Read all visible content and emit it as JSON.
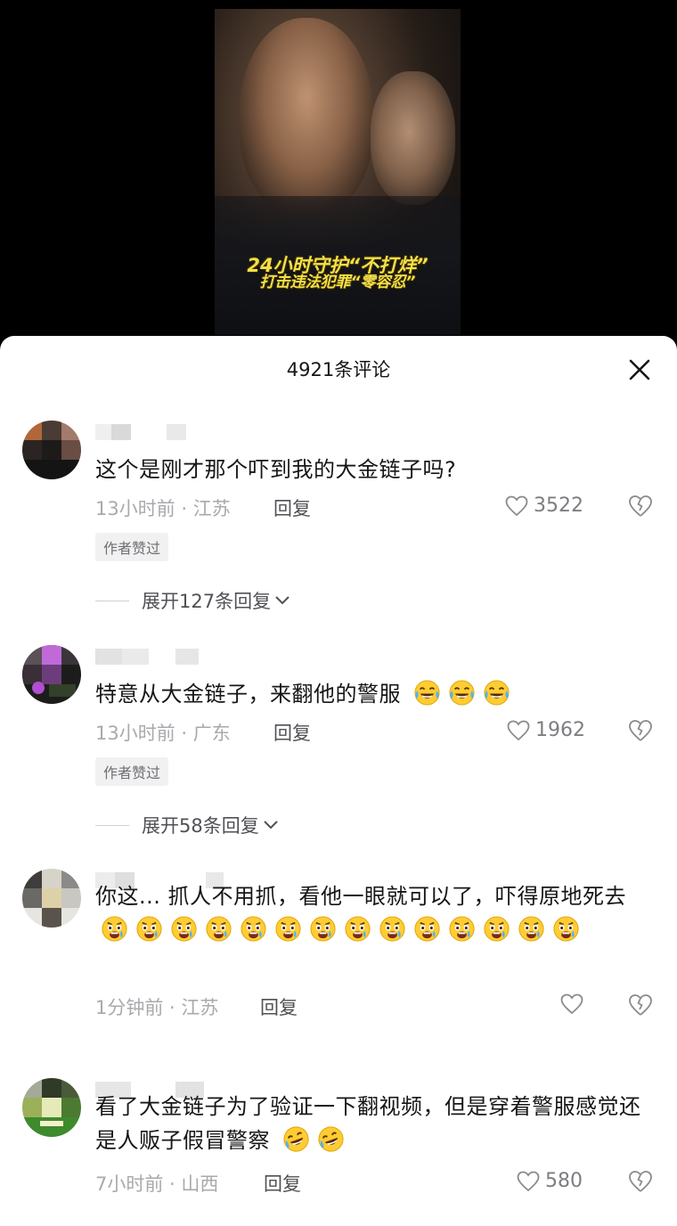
{
  "video": {
    "caption_line1": "24小时守护“不打烊”",
    "caption_line2": "打击违法犯罪“零容忍”"
  },
  "sheet": {
    "title": "4921条评论"
  },
  "comments": [
    {
      "text": "这个是刚才那个吓到我的大金链子吗?",
      "meta": "13小时前 · 江苏",
      "reply_label": "回复",
      "likes": "3522",
      "badge": "作者赞过",
      "expand": "展开127条回复"
    },
    {
      "text": "特意从大金链子，来翻他的警服",
      "emoji": "laugh-cry-emoji",
      "emoji_count": 3,
      "meta": "13小时前 · 广东",
      "reply_label": "回复",
      "likes": "1962",
      "badge": "作者赞过",
      "expand": "展开58条回复"
    },
    {
      "text": "你这... 抓人不用抓，看他一眼就可以了，吓得原地死去",
      "emoji": "scared-emoji",
      "emoji_count": 14,
      "meta": "1分钟前 · 江苏",
      "reply_label": "回复",
      "likes": ""
    },
    {
      "text": "看了大金链子为了验证一下翻视频，但是穿着警服感觉还是人贩子假冒警察",
      "emoji": "rofl-emoji",
      "emoji_count": 2,
      "meta": "7小时前 · 山西",
      "reply_label": "回复",
      "likes": "580"
    }
  ],
  "colors": {
    "sheet_bg": "#ffffff",
    "text_primary": "#161616",
    "text_meta": "#a9a9ae",
    "caption_yellow": "#f3e04a"
  }
}
